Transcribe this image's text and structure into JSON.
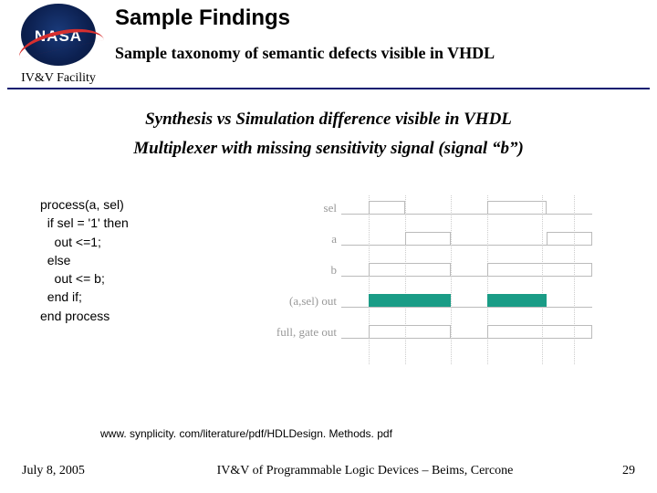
{
  "header": {
    "logo_text": "NASA",
    "ivv_label": "IV&V Facility",
    "title": "Sample Findings",
    "subtitle": "Sample taxonomy of semantic defects visible in VHDL"
  },
  "body": {
    "line1": "Synthesis vs Simulation difference visible in VHDL",
    "line2": "Multiplexer with missing sensitivity signal (signal “b”)",
    "code": "process(a, sel)\n  if sel = '1' then\n    out <=1;\n  else\n    out <= b;\n  end if;\nend process"
  },
  "timing": {
    "signals": [
      "sel",
      "a",
      "b",
      "(a,sel) out",
      "full, gate out"
    ]
  },
  "citation": "www. synplicity. com/literature/pdf/HDLDesign. Methods. pdf",
  "footer": {
    "date": "July 8, 2005",
    "center": "IV&V of Programmable Logic Devices – Beims, Cercone",
    "page": "29"
  }
}
